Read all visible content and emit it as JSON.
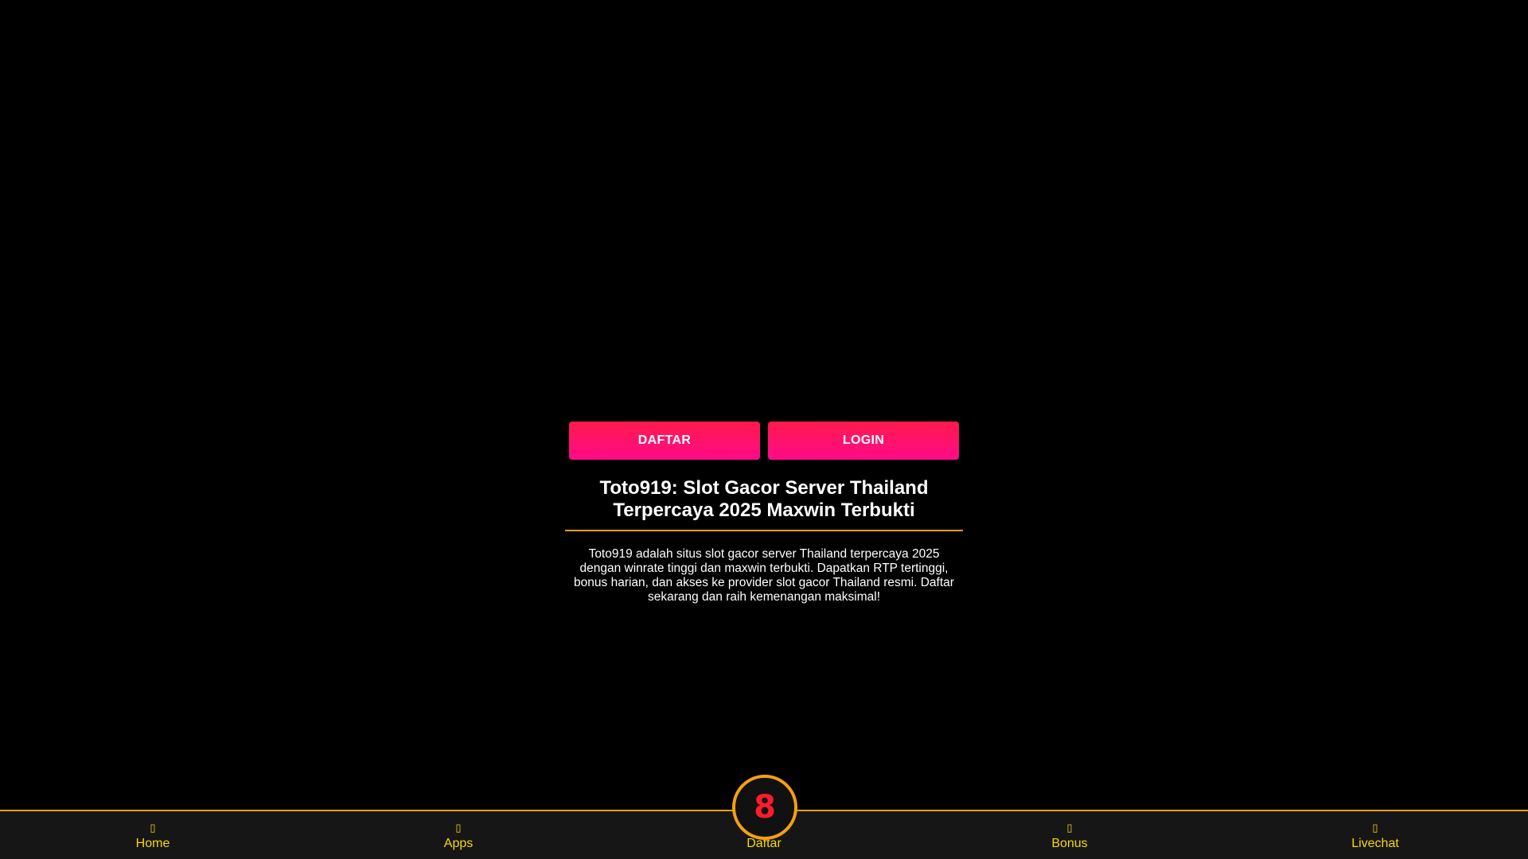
{
  "buttons": {
    "daftar": "DAFTAR",
    "login": "LOGIN"
  },
  "main": {
    "title": "Toto919: Slot Gacor Server Thailand Terpercaya 2025 Maxwin Terbukti",
    "description": "Toto919 adalah situs slot gacor server Thailand terpercaya 2025 dengan winrate tinggi dan maxwin terbukti. Dapatkan RTP tertinggi, bonus harian, dan akses ke provider slot gacor Thailand resmi. Daftar sekarang dan raih kemenangan maksimal!"
  },
  "bottom_nav": {
    "items": [
      {
        "label": "Home",
        "icon": "home-icon"
      },
      {
        "label": "Apps",
        "icon": "apps-icon"
      },
      {
        "label": "Daftar",
        "icon": "daftar-logo-icon"
      },
      {
        "label": "Bonus",
        "icon": "bonus-icon"
      },
      {
        "label": "Livechat",
        "icon": "livechat-icon"
      }
    ],
    "center_logo_text": "8"
  },
  "colors": {
    "background": "#000000",
    "button_gradient_top": "#ff1a4a",
    "button_gradient_bottom": "#ff0b8a",
    "accent_orange": "#f5a00f",
    "nav_text": "#f5d90a",
    "nav_bg": "#161616",
    "logo_red": "#ff1a2e"
  }
}
